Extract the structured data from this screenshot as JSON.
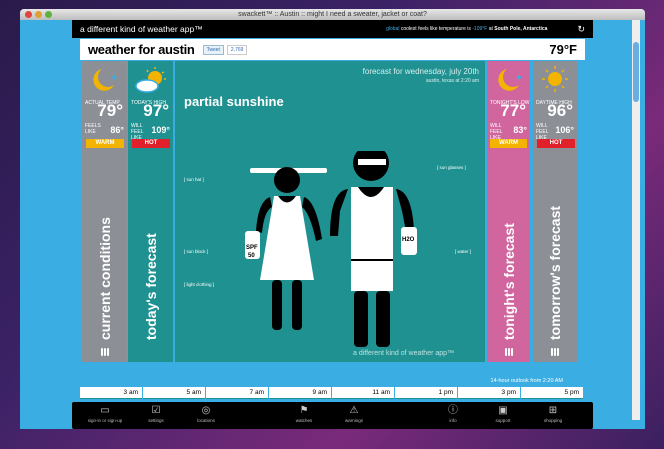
{
  "window": {
    "title": "swackett™ :: Austin :: might I need a sweater, jacket or coat?"
  },
  "header": {
    "brand": "a different kind of weather app™",
    "global_label": "global",
    "global_text": " coolest feels like temperature is ",
    "global_temp": "-109°F",
    "global_at": " at ",
    "global_place": "South Pole, Antarctica",
    "refresh_icon": "refresh-icon"
  },
  "titlebar": {
    "title": "weather for austin",
    "tweet": "Tweet",
    "tweet_count": "2,769",
    "current_temp": "79°F"
  },
  "columns": {
    "current": {
      "label": "ACTUAL TEMP",
      "temp": "79°",
      "feels_label": "FEELS LIKE",
      "feels": "86°",
      "badge": "WARM",
      "vertical": "current conditions"
    },
    "today": {
      "label": "TODAY'S HIGH",
      "temp": "97°",
      "feels_label": "WILL FEEL LIKE",
      "feels": "109°",
      "badge": "HOT",
      "vertical": "today's forecast"
    },
    "tonight": {
      "label": "TONIGHT'S LOW",
      "temp": "77°",
      "feels_label": "WILL FEEL LIKE",
      "feels": "83°",
      "badge": "WARM",
      "vertical": "tonight's forecast"
    },
    "tomorrow": {
      "label": "DAYTIME HIGH",
      "temp": "96°",
      "feels_label": "WILL FEEL LIKE",
      "feels": "106°",
      "badge": "HOT",
      "vertical": "tomorrow's forecast"
    }
  },
  "main": {
    "forecast": "forecast for wednesday, july 20th",
    "location": "austin, texas at 2:20 am",
    "condition": "partial sunshine",
    "footer": "a different kind of weather app™",
    "annotations": {
      "sun_hat": "[ sun hat ]",
      "sun_block": "[ sun block ]",
      "light_clothing": "[ light clothing ]",
      "sun_glasses": "[ sun glasses ]",
      "water": "[ water ]"
    },
    "spf": "SPF",
    "spf_num": "50",
    "h2o": "H2O"
  },
  "outlook": {
    "title": "14-hour outlook from 2:20 AM",
    "hours": [
      "3 am",
      "5 am",
      "7 am",
      "9 am",
      "11 am",
      "1 pm",
      "3 pm",
      "5 pm"
    ]
  },
  "footer": {
    "items": [
      "sign-in or sign-up",
      "settings",
      "locations",
      "watches",
      "warnings",
      "info",
      "support",
      "shopping"
    ]
  },
  "colors": {
    "warm": "#f2b400",
    "hot": "#e0202a",
    "teal": "#1f9191",
    "pink": "#d1669f",
    "gray": "#8c8f96",
    "blue": "#3aaee3"
  }
}
